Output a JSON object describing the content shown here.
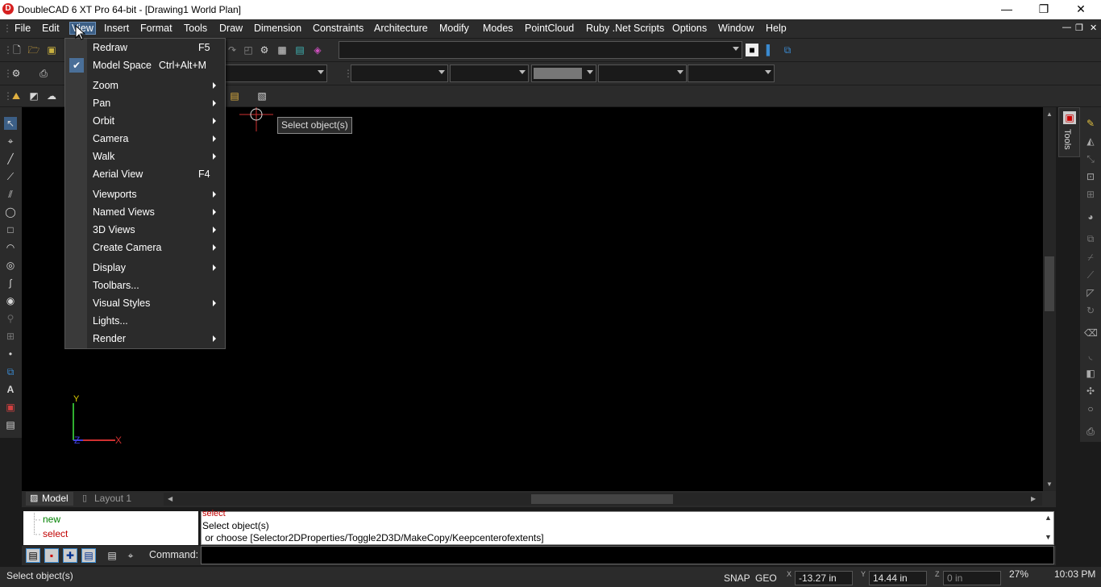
{
  "window": {
    "title": "DoubleCAD 6 XT Pro 64-bit - [Drawing1 World Plan]",
    "logo_letter": "D",
    "minimize": "—",
    "restore": "❐",
    "close": "✕"
  },
  "menubar": {
    "items": [
      "File",
      "Edit",
      "View",
      "Insert",
      "Format",
      "Tools",
      "Draw",
      "Dimension",
      "Constraints",
      "Architecture",
      "Modify",
      "Modes",
      "PointCloud",
      "Ruby .Net Scripts",
      "Options",
      "Window",
      "Help"
    ],
    "active": "View",
    "mdi_min": "—",
    "mdi_restore": "❐",
    "mdi_close": "✕"
  },
  "view_menu": {
    "items": [
      {
        "label": "Redraw",
        "shortcut": "F5",
        "submenu": false,
        "checked": false
      },
      {
        "label": "Model Space",
        "shortcut": "Ctrl+Alt+M",
        "submenu": false,
        "checked": true
      },
      {
        "label": "Zoom",
        "shortcut": "",
        "submenu": true,
        "checked": false
      },
      {
        "label": "Pan",
        "shortcut": "",
        "submenu": true,
        "checked": false
      },
      {
        "label": "Orbit",
        "shortcut": "",
        "submenu": true,
        "checked": false
      },
      {
        "label": "Camera",
        "shortcut": "",
        "submenu": true,
        "checked": false
      },
      {
        "label": "Walk",
        "shortcut": "",
        "submenu": true,
        "checked": false
      },
      {
        "label": "Aerial View",
        "shortcut": "F4",
        "submenu": false,
        "checked": false
      },
      {
        "label": "Viewports",
        "shortcut": "",
        "submenu": true,
        "checked": false
      },
      {
        "label": "Named Views",
        "shortcut": "",
        "submenu": true,
        "checked": false
      },
      {
        "label": "3D Views",
        "shortcut": "",
        "submenu": true,
        "checked": false
      },
      {
        "label": "Create Camera",
        "shortcut": "",
        "submenu": true,
        "checked": false
      },
      {
        "label": "Display",
        "shortcut": "",
        "submenu": true,
        "checked": false
      },
      {
        "label": "Toolbars...",
        "shortcut": "",
        "submenu": false,
        "checked": false
      },
      {
        "label": "Visual Styles",
        "shortcut": "",
        "submenu": true,
        "checked": false
      },
      {
        "label": "Lights...",
        "shortcut": "",
        "submenu": false,
        "checked": false
      },
      {
        "label": "Render",
        "shortcut": "",
        "submenu": true,
        "checked": false
      }
    ],
    "check_glyph": "✔"
  },
  "canvas": {
    "tooltip": "Select object(s)",
    "axis_x": "X",
    "axis_y": "Y",
    "axis_z": "Z"
  },
  "tools_panel": {
    "label": "Tools"
  },
  "layout_tabs": [
    {
      "label": "Model",
      "active": true
    },
    {
      "label": "Layout 1",
      "active": false
    }
  ],
  "command_tree": {
    "items": [
      "new",
      "select"
    ]
  },
  "command_history": {
    "lines": [
      "select",
      "Select object(s)",
      " or choose [Selector2DProperties/Toggle2D3D/MakeCopy/Keepcenterofextents]"
    ]
  },
  "command": {
    "label": "Command:",
    "value": ""
  },
  "status": {
    "message": "Select object(s)",
    "snap": "SNAP",
    "geo": "GEO",
    "x_label": "X",
    "x_value": "-13.27 in",
    "y_label": "Y",
    "y_value": "14.44 in",
    "z_label": "Z",
    "z_value": "0 in",
    "zoom": "27%",
    "time": "10:03 PM"
  },
  "colors": {
    "menu_active": "#3c5f86",
    "canvas": "#000000",
    "axis_x": "#d03030",
    "axis_y": "#30b030",
    "axis_z": "#4040e0",
    "history_highlight": "#c00000",
    "tree_new": "#008000",
    "tree_select": "#c00000"
  }
}
